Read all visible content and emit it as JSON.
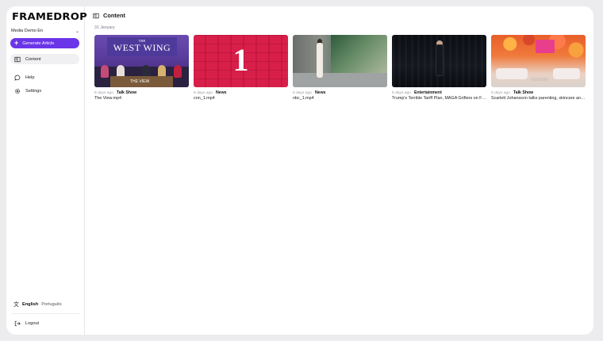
{
  "app": {
    "logo": "FRAMEDROP"
  },
  "sidebar": {
    "workspace": "Media Demo En",
    "generate_button": "Generate Article",
    "items": [
      {
        "label": "Content",
        "icon": "content-icon",
        "active": true
      },
      {
        "label": "Help",
        "icon": "help-icon",
        "active": false
      },
      {
        "label": "Settings",
        "icon": "gear-icon",
        "active": false
      }
    ],
    "languages": {
      "active": "English",
      "other": "Português"
    },
    "logout": "Logout"
  },
  "main": {
    "title": "Content",
    "date_group": "31 January",
    "cards": [
      {
        "ago": "6 days ago",
        "category": "Talk Show",
        "filename": "The View.mp4",
        "thumb_text": [
          "THE",
          "WEST WING",
          "THE VIEW"
        ]
      },
      {
        "ago": "6 days ago",
        "category": "News",
        "filename": "cnn_1.mp4",
        "thumb_text": [
          "1"
        ]
      },
      {
        "ago": "6 days ago",
        "category": "News",
        "filename": "nbc_1.mp4"
      },
      {
        "ago": "6 days ago",
        "category": "Entertainment",
        "filename": "Trump's Terrible Tariff Plan, MAGA Grifters on Fire & Joe Biden's Finish Line Is in Sight"
      },
      {
        "ago": "6 days ago",
        "category": "Talk Show",
        "filename": "Scarlett Johansson talks parenting, skincare and more"
      }
    ]
  },
  "colors": {
    "accent": "#6b35e8",
    "background": "#ececef"
  }
}
